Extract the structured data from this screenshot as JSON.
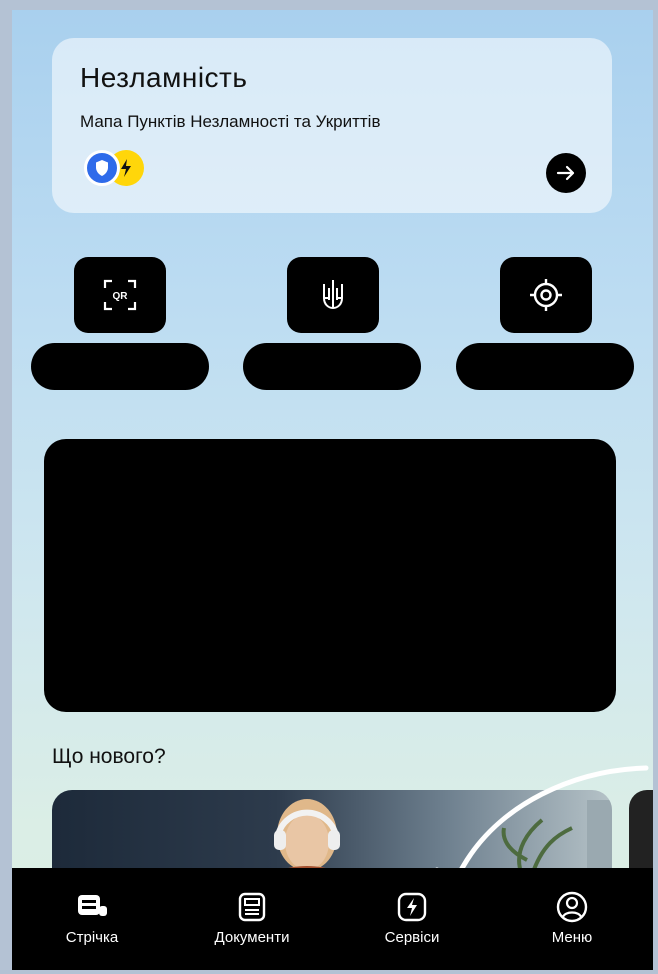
{
  "card": {
    "title": "Незламність",
    "subtitle": "Мапа Пунктів Незламності та Укриттів"
  },
  "quick_actions": [
    {
      "icon": "qr-scan-icon",
      "label": "QR"
    },
    {
      "icon": "trident-icon"
    },
    {
      "icon": "target-icon"
    }
  ],
  "news": {
    "heading": "Що нового?"
  },
  "tabbar": {
    "items": [
      {
        "label": "Стрічка",
        "icon": "feed-icon"
      },
      {
        "label": "Документи",
        "icon": "documents-icon"
      },
      {
        "label": "Сервіси",
        "icon": "services-bolt-icon"
      },
      {
        "label": "Меню",
        "icon": "profile-icon"
      }
    ]
  },
  "colors": {
    "accent_blue": "#2f6bea",
    "accent_yellow": "#ffd60a",
    "dark": "#000000"
  }
}
